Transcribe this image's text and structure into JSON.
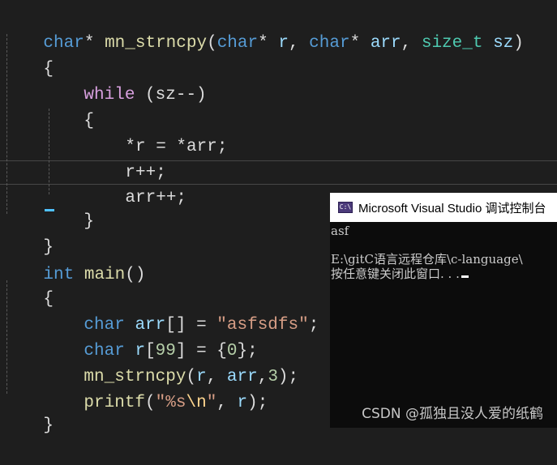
{
  "editor": {
    "lines": {
      "sig_type1": "char",
      "sig_star1": "* ",
      "sig_fn": "mn_strncpy",
      "sig_paren_open": "(",
      "sig_type2": "char",
      "sig_star2": "* ",
      "sig_p1": "r",
      "sig_comma1": ", ",
      "sig_type3": "char",
      "sig_star3": "* ",
      "sig_p2": "arr",
      "sig_comma2": ", ",
      "sig_type4": "size_t",
      "sig_space": " ",
      "sig_p3": "sz",
      "sig_paren_close": ")",
      "brace_open1": "{",
      "while_kw": "while",
      "while_cond": " (sz--)",
      "brace_open2": "{",
      "stmt1": "*r = *arr;",
      "stmt2": "r++;",
      "stmt3": "arr++;",
      "brace_close2": "}",
      "brace_close1": "}",
      "main_type": "int",
      "main_fn": "main",
      "main_parens": "()",
      "brace_open3": "{",
      "decl1_type": "char",
      "decl1_name": "arr",
      "decl1_rest": "[] = ",
      "decl1_str": "\"asfsdfs\"",
      "decl1_semi": ";",
      "decl2_type": "char",
      "decl2_name": "r",
      "decl2_pre": "[",
      "decl2_num": "99",
      "decl2_mid": "] = {",
      "decl2_zero": "0",
      "decl2_end": "};",
      "call_fn": "mn_strncpy",
      "call_args_a": "(",
      "call_r": "r",
      "call_args_b": ", ",
      "call_arr": "arr",
      "call_args_c": ",",
      "call_num": "3",
      "call_args_d": ");",
      "printf_fn": "printf",
      "printf_open": "(",
      "printf_str_a": "\"%s",
      "printf_esc": "\\n",
      "printf_str_b": "\"",
      "printf_comma": ", ",
      "printf_r": "r",
      "printf_close": ");",
      "brace_close3": "}"
    }
  },
  "console": {
    "title": "Microsoft Visual Studio 调试控制台",
    "icon_text": "C:\\",
    "output_line1": "asf",
    "output_line2": "E:\\gitC语言远程仓库\\c-language\\",
    "output_line3": "按任意键关闭此窗口. . ."
  },
  "watermark": "CSDN @孤独且没人爱的纸鹤",
  "colors": {
    "background": "#1e1e1e",
    "keyword": "#569cd6",
    "function": "#dcdcaa",
    "type": "#4ec9b0",
    "parameter": "#9cdcfe",
    "string": "#d69d85",
    "control": "#d8a0df"
  }
}
